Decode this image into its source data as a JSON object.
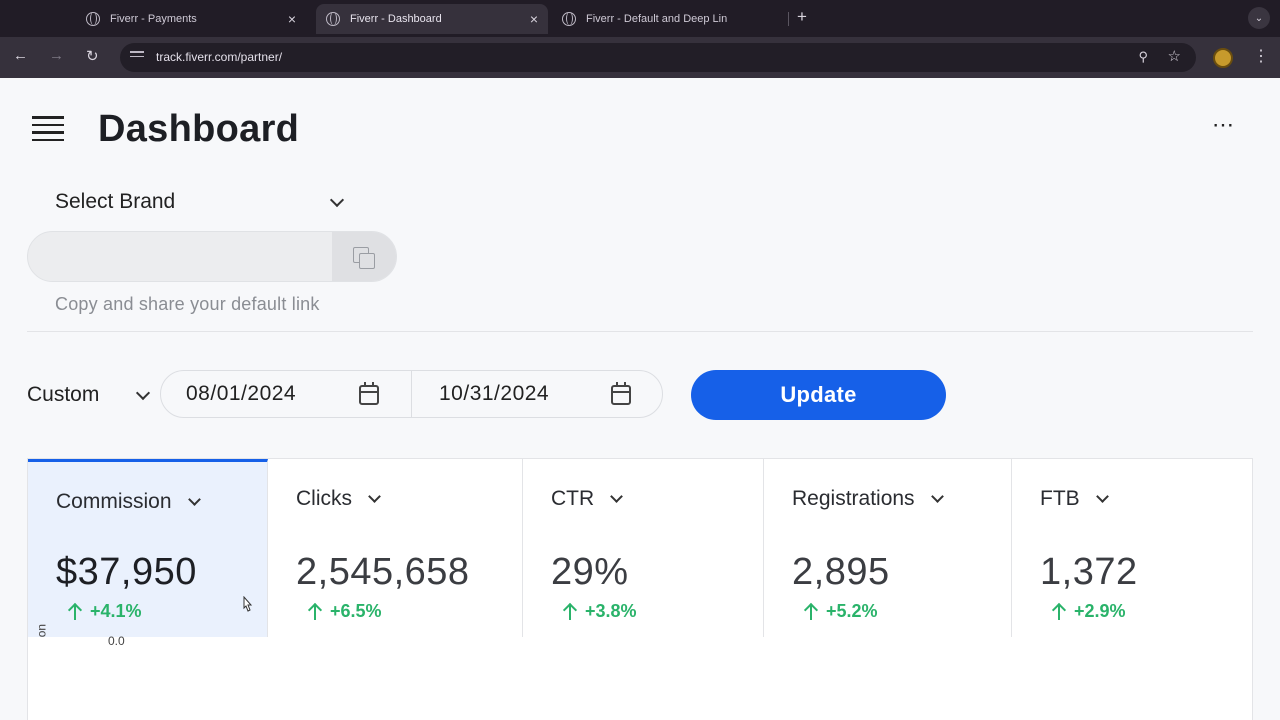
{
  "browser": {
    "tabs": [
      {
        "title": "Fiverr - Payments",
        "active": false
      },
      {
        "title": "Fiverr - Dashboard",
        "active": true
      },
      {
        "title": "Fiverr - Default and Deep Lin",
        "active": false
      }
    ],
    "close_glyph": "×",
    "new_tab_glyph": "+",
    "url": "track.fiverr.com/partner/"
  },
  "header": {
    "title": "Dashboard",
    "menu_icon": "hamburger-icon",
    "more_icon": "more-horizontal-icon"
  },
  "brand": {
    "select_label": "Select Brand",
    "link_value": "",
    "helper_text": "Copy and share your default link"
  },
  "date_filter": {
    "range_label": "Custom",
    "start_date": "08/01/2024",
    "end_date": "10/31/2024",
    "update_label": "Update"
  },
  "metrics": [
    {
      "label": "Commission",
      "value": "$37,950",
      "delta": "+4.1%",
      "active": true
    },
    {
      "label": "Clicks",
      "value": "2,545,658",
      "delta": "+6.5%",
      "active": false
    },
    {
      "label": "CTR",
      "value": "29%",
      "delta": "+3.8%",
      "active": false
    },
    {
      "label": "Registrations",
      "value": "2,895",
      "delta": "+5.2%",
      "active": false
    },
    {
      "label": "FTB",
      "value": "1,372",
      "delta": "+2.9%",
      "active": false
    }
  ],
  "colors": {
    "accent": "#1660e8",
    "positive": "#2ab36a",
    "active_card_bg": "#eaf1fd"
  },
  "chart": {
    "axis_label_partial": "uo",
    "first_tick": "0.0"
  }
}
